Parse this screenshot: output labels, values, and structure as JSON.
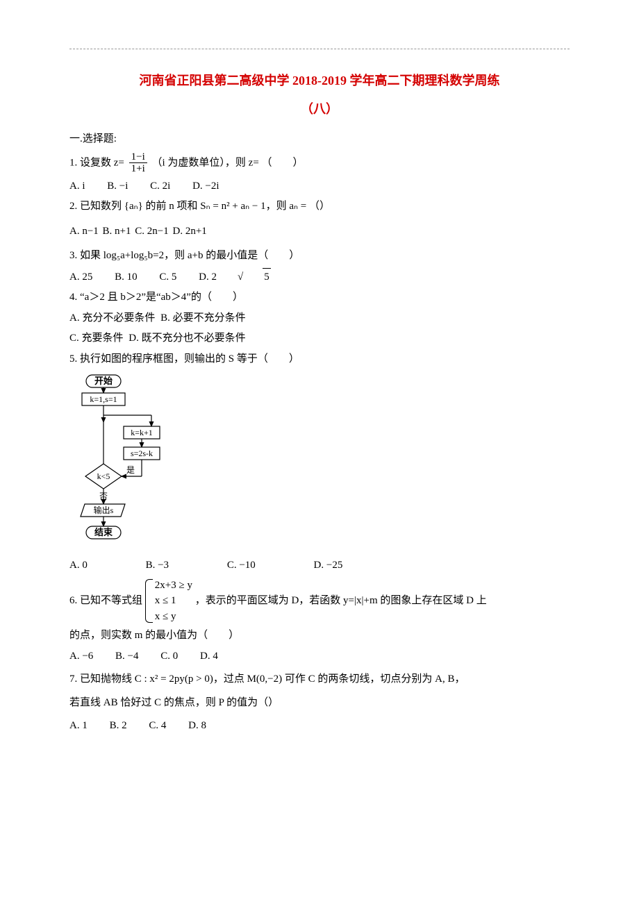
{
  "header": {
    "title": "河南省正阳县第二高级中学 2018-2019 学年高二下期理科数学周练",
    "subtitle": "（八）"
  },
  "section_label": "一.选择题:",
  "q1": {
    "stem_prefix": "1. 设复数 z=",
    "num": "1−i",
    "den": "1+i",
    "stem_suffix": "（i 为虚数单位），则 z= （　　）",
    "A": "A. i",
    "B": "B. −i",
    "C": "C. 2i",
    "D": "D. −2i"
  },
  "q2": {
    "stem": "2. 已知数列 {aₙ} 的前 n 项和 Sₙ = n² + aₙ − 1，则 aₙ = （）",
    "A": "A. n−1",
    "B": "B. n+1",
    "C": "C. 2n−1",
    "D": "D. 2n+1"
  },
  "q3": {
    "stem": "3. 如果 log₅a+log₅b=2，则 a+b 的最小值是（　　）",
    "A": "A. 25",
    "B": "B. 10",
    "C": "C. 5",
    "D_prefix": "D. 2",
    "D_rad": "5"
  },
  "q4": {
    "stem": "4. “a＞2 且 b＞2”是“ab＞4”的（　　）",
    "A": "A. 充分不必要条件",
    "B": "B. 必要不充分条件",
    "C": "C. 充要条件",
    "D": "D. 既不充分也不必要条件"
  },
  "q5": {
    "stem": "5. 执行如图的程序框图，则输出的 S 等于（　　）",
    "A": "A. 0",
    "B": "B. −3",
    "C": "C. −10",
    "D": "D. −25"
  },
  "flow": {
    "start": "开始",
    "init": "k=1,s=1",
    "inc": "k=k+1",
    "upd": "s=2s-k",
    "cond": "k<5",
    "yes": "是",
    "no": "否",
    "out": "输出s",
    "end": "结束"
  },
  "q6": {
    "stem_prefix": "6. 已知不等式组",
    "sys1": "2x+3 ≥ y",
    "sys2": "x ≤ 1",
    "sys3": "x ≤ y",
    "stem_mid": "，表示的平面区域为 D，若函数 y=|x|+m 的图象上存在区域 D 上",
    "stem_tail": "的点，则实数 m 的最小值为（　　）",
    "A": "A. −6",
    "B": "B. −4",
    "C": "C. 0",
    "D": "D. 4"
  },
  "q7": {
    "stem_a": "7. 已知抛物线 C : x² = 2py(p > 0)，过点 M(0,−2) 可作 C 的两条切线，切点分别为 A, B，",
    "stem_b": "若直线 AB 恰好过 C 的焦点，则 P 的值为（）",
    "A": "A. 1",
    "B": "B. 2",
    "C": "C. 4",
    "D": "D. 8"
  }
}
